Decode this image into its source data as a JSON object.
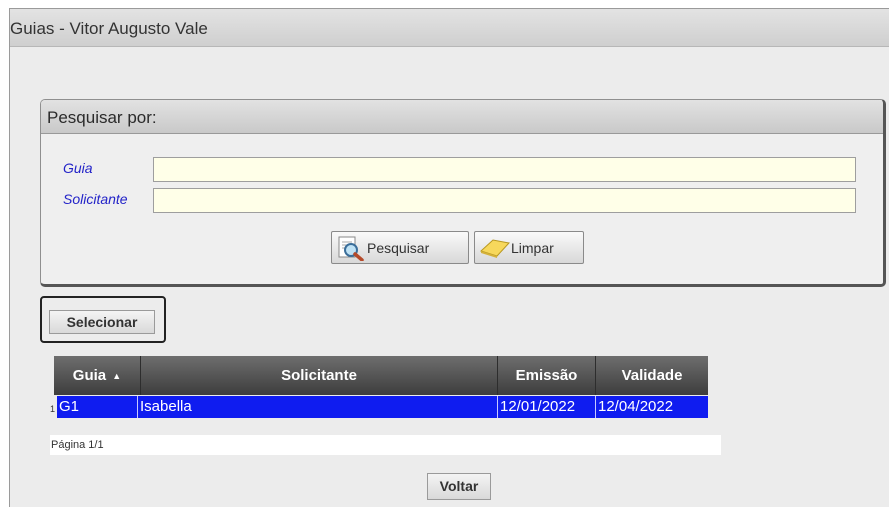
{
  "window": {
    "title": "Guias - Vitor Augusto Vale"
  },
  "search": {
    "header": "Pesquisar por:",
    "fields": [
      {
        "label": "Guia",
        "value": ""
      },
      {
        "label": "Solicitante",
        "value": ""
      }
    ],
    "search_button": "Pesquisar",
    "clear_button": "Limpar"
  },
  "select_button": "Selecionar",
  "grid": {
    "columns": [
      "Guia",
      "Solicitante",
      "Emissão",
      "Validade"
    ],
    "rows": [
      {
        "index": "1",
        "guia": "G1",
        "solicitante": "Isabella",
        "emissao": "12/01/2022",
        "validade": "12/04/2022"
      }
    ],
    "pager": "Página 1/1"
  },
  "back_button": "Voltar",
  "colors": {
    "selected_row": "#0f1cf0",
    "label_text": "#2323c8",
    "input_bg": "#ffffe8"
  },
  "icons": {
    "search": "magnifier-document-icon",
    "clear": "eraser-icon",
    "sort": "sort-ascending-icon"
  }
}
